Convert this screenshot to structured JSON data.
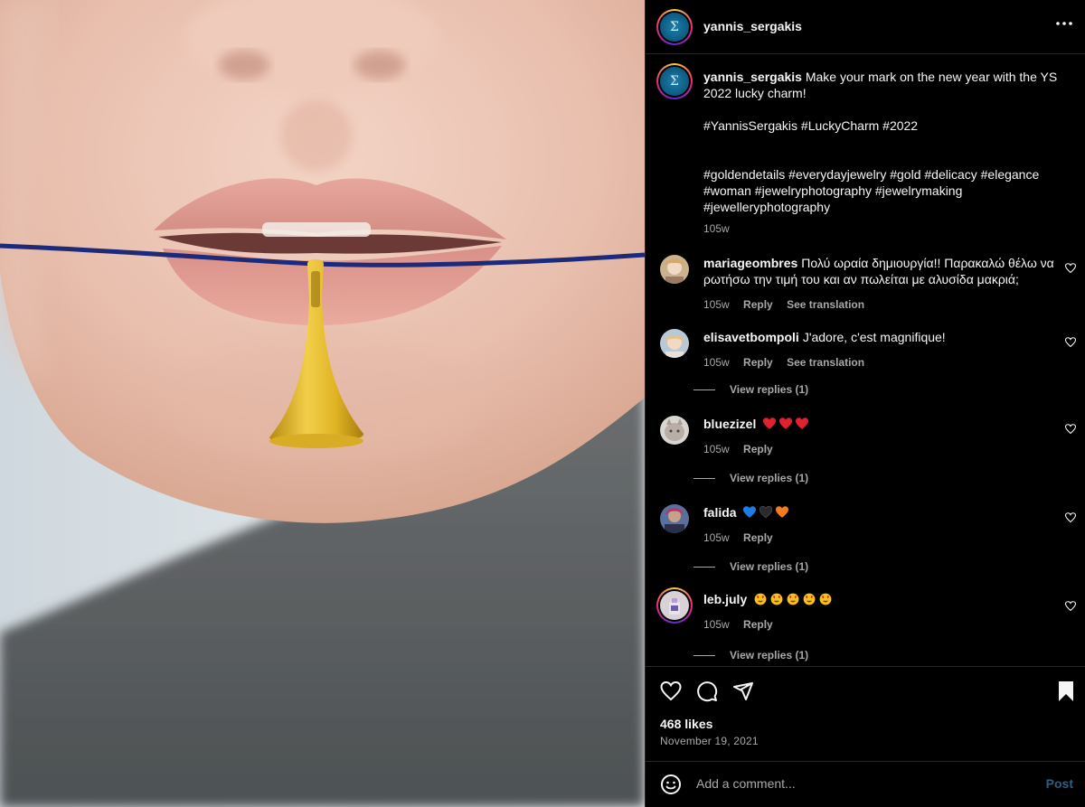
{
  "post": {
    "author": "yannis_sergakis",
    "avatar_glyph": "Σ",
    "caption_text": "Make your mark on the new year with the YS 2022 lucky charm!",
    "caption_tags_1": "#YannisSergakis #LuckyCharm #2022",
    "caption_tags_2": "#goldendetails #everydayjewelry #gold #delicacy #elegance #woman #jewelryphotography #jewelrymaking #jewelleryphotography",
    "caption_time": "105w",
    "likes": "468 likes",
    "date": "November 19, 2021"
  },
  "labels": {
    "reply": "Reply",
    "see_translation": "See translation",
    "view_replies": "View replies (1)",
    "add_comment_placeholder": "Add a comment...",
    "post_button": "Post"
  },
  "comments": [
    {
      "user": "mariageombres",
      "text": "Πολύ ωραία δημιουργία!! Παρακαλώ θέλω να ρωτήσω την τιμή του και αν πωλείται με αλυσίδα μακριά;",
      "time": "105w"
    },
    {
      "user": "elisavetbompoli",
      "text": "J'adore, c'est magnifique!",
      "time": "105w"
    },
    {
      "user": "bluezizel",
      "text": "",
      "emojis": [
        "red-heart",
        "red-heart",
        "red-heart"
      ],
      "time": "105w"
    },
    {
      "user": "falida",
      "text": "",
      "emojis": [
        "blue-heart",
        "black-heart",
        "orange-heart"
      ],
      "time": "105w"
    },
    {
      "user": "leb.july",
      "text": "",
      "emojis": [
        "heart-eyes",
        "heart-eyes",
        "heart-eyes",
        "heart-eyes",
        "heart-eyes"
      ],
      "time": "105w"
    }
  ],
  "colors": {
    "background": "#000000",
    "muted_text": "#a8a8a8",
    "post_button": "#2a5f86",
    "divider": "#262626"
  },
  "icons": [
    "more-icon",
    "heart-icon",
    "comment-icon",
    "share-icon",
    "bookmark-icon",
    "emoji-icon"
  ]
}
